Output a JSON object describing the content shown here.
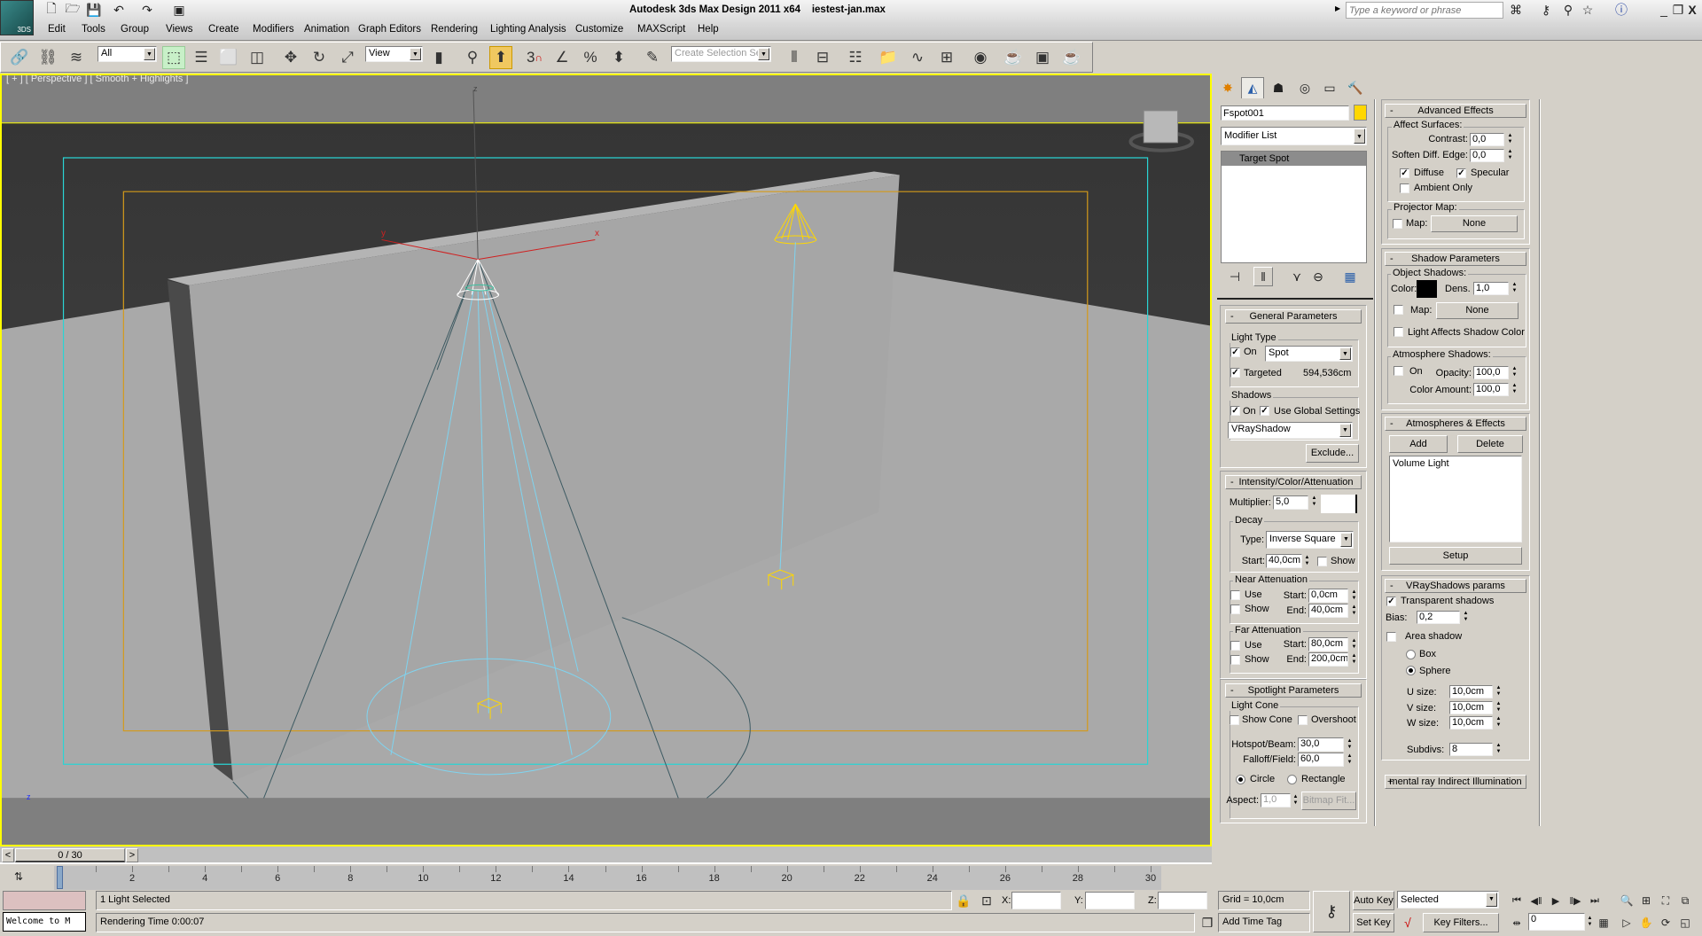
{
  "title": {
    "app": "Autodesk 3ds Max Design 2011 x64",
    "file": "iestest-jan.max",
    "logo": "3DS"
  },
  "search": {
    "placeholder": "Type a keyword or phrase"
  },
  "menu": [
    "Edit",
    "Tools",
    "Group",
    "Views",
    "Create",
    "Modifiers",
    "Animation",
    "Graph Editors",
    "Rendering",
    "Lighting Analysis",
    "Customize",
    "MAXScript",
    "Help"
  ],
  "toolbar": {
    "selection_filter": "All",
    "ref_coord": "View",
    "snap_label": "3",
    "named_selection_placeholder": "Create Selection Se"
  },
  "viewport": {
    "label": "[ + ] [ Perspective ] [ Smooth + Highlights ]",
    "axis_x": "x",
    "axis_y": "y",
    "axis_z": "z",
    "corner_axis": "z"
  },
  "colors": {
    "selection": "#ffff00",
    "light": "#ffd700",
    "cone": "#7fd4f0",
    "safe_frame": "#2ad4d4",
    "render_frame": "#d49a1a"
  },
  "command_panel": {
    "tabs": [
      "create",
      "modify",
      "hierarchy",
      "motion",
      "display",
      "utilities"
    ],
    "active_tab": "modify",
    "object_name": "Fspot001",
    "object_color": "#ffd700",
    "modifier_list": "Modifier List",
    "stack": [
      "Target Spot"
    ],
    "general": {
      "title": "General Parameters",
      "light_type_label": "Light Type",
      "on_label": "On",
      "on": true,
      "type": "Spot",
      "targeted_label": "Targeted",
      "targeted": true,
      "target_distance": "594,536cm",
      "shadows_label": "Shadows",
      "shadows_on_label": "On",
      "shadows_on": true,
      "use_global_label": "Use Global Settings",
      "use_global": true,
      "shadow_type": "VRayShadow",
      "exclude": "Exclude..."
    },
    "intensity": {
      "title": "Intensity/Color/Attenuation",
      "multiplier_label": "Multiplier:",
      "multiplier": "5,0",
      "light_color": "#ffffff",
      "decay_label": "Decay",
      "type_label": "Type:",
      "decay_type": "Inverse Square",
      "start_label": "Start:",
      "decay_start": "40,0cm",
      "show_label": "Show",
      "decay_show": false,
      "near": {
        "label": "Near Attenuation",
        "use_label": "Use",
        "show_label": "Show",
        "start_label": "Start:",
        "end_label": "End:",
        "start": "0,0cm",
        "end": "40,0cm",
        "use": false,
        "show": false
      },
      "far": {
        "label": "Far Attenuation",
        "use_label": "Use",
        "show_label": "Show",
        "start_label": "Start:",
        "end_label": "End:",
        "start": "80,0cm",
        "end": "200,0cm",
        "use": false,
        "show": false
      }
    },
    "spotlight": {
      "title": "Spotlight Parameters",
      "light_cone_label": "Light Cone",
      "show_cone_label": "Show Cone",
      "show_cone": false,
      "overshoot_label": "Overshoot",
      "overshoot": false,
      "hotspot_label": "Hotspot/Beam:",
      "hotspot": "30,0",
      "falloff_label": "Falloff/Field:",
      "falloff": "60,0",
      "circle_label": "Circle",
      "rectangle_label": "Rectangle",
      "shape": "circle",
      "aspect_label": "Aspect:",
      "aspect": "1,0",
      "bitmap_fit": "Bitmap Fit..."
    },
    "advanced": {
      "title": "Advanced Effects",
      "affect_label": "Affect Surfaces:",
      "contrast_label": "Contrast:",
      "contrast": "0,0",
      "soften_label": "Soften Diff. Edge:",
      "soften": "0,0",
      "diffuse_label": "Diffuse",
      "diffuse": true,
      "specular_label": "Specular",
      "specular": true,
      "ambient_label": "Ambient Only",
      "ambient": false,
      "projector_label": "Projector Map:",
      "map_label": "Map:",
      "map": "None"
    },
    "shadow_params": {
      "title": "Shadow Parameters",
      "object_label": "Object Shadows:",
      "color_label": "Color:",
      "shadow_color": "#000000",
      "dens_label": "Dens.",
      "dens": "1,0",
      "map_label": "Map:",
      "map": "None",
      "light_affects_label": "Light Affects Shadow Color",
      "atmo_label": "Atmosphere Shadows:",
      "atmo_on_label": "On",
      "opacity_label": "Opacity:",
      "opacity": "100,0",
      "color_amount_label": "Color Amount:",
      "color_amount": "100,0"
    },
    "atmospheres": {
      "title": "Atmospheres & Effects",
      "add": "Add",
      "delete": "Delete",
      "items": [
        "Volume Light"
      ],
      "setup": "Setup"
    },
    "vray": {
      "title": "VRayShadows params",
      "transparent_label": "Transparent shadows",
      "transparent": true,
      "bias_label": "Bias:",
      "bias": "0,2",
      "area_label": "Area shadow",
      "area": false,
      "box_label": "Box",
      "sphere_label": "Sphere",
      "shape": "sphere",
      "u_label": "U size:",
      "u": "10,0cm",
      "v_label": "V size:",
      "v": "10,0cm",
      "w_label": "W size:",
      "w": "10,0cm",
      "subdivs_label": "Subdivs:",
      "subdivs": "8"
    },
    "mental_ray": {
      "title": "mental ray Indirect Illumination"
    }
  },
  "timeline": {
    "slider": "0 / 30",
    "prev": "<",
    "next": ">",
    "current": 0,
    "end": 30,
    "labels": [
      0,
      2,
      4,
      6,
      8,
      10,
      12,
      14,
      16,
      18,
      20,
      22,
      24,
      26,
      28,
      30
    ]
  },
  "status": {
    "selection": "1 Light Selected",
    "render_time": "Rendering Time  0:00:07",
    "maxscript": "Welcome to M",
    "x_label": "X:",
    "y_label": "Y:",
    "z_label": "Z:",
    "x": "",
    "y": "",
    "z": "",
    "grid": "Grid = 10,0cm",
    "add_time_tag": "Add Time Tag",
    "auto_key": "Auto Key",
    "set_key": "Set Key",
    "key_mode": "Selected",
    "key_filters": "Key Filters...",
    "frame": "0"
  }
}
